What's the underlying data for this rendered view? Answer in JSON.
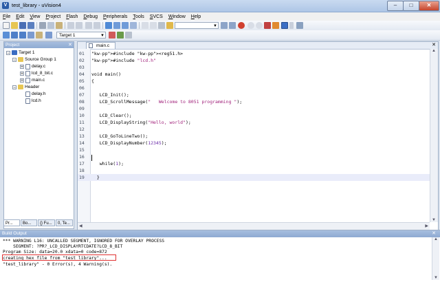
{
  "window": {
    "title": "test_library - uVision4",
    "min": "–",
    "max": "□",
    "close": "✕"
  },
  "menu": [
    "File",
    "Edit",
    "View",
    "Project",
    "Flash",
    "Debug",
    "Peripherals",
    "Tools",
    "SVCS",
    "Window",
    "Help"
  ],
  "toolbar": {
    "target_select": "Target 1"
  },
  "project": {
    "title": "Project",
    "close": "✕",
    "tree": [
      {
        "label": "Target 1",
        "level": 0,
        "kind": "target",
        "expander": "−"
      },
      {
        "label": "Source Group 1",
        "level": 1,
        "kind": "folder",
        "expander": "−"
      },
      {
        "label": "delay.c",
        "level": 2,
        "kind": "file",
        "expander": "+"
      },
      {
        "label": "lcd_8_bit.c",
        "level": 2,
        "kind": "file",
        "expander": "+"
      },
      {
        "label": "main.c",
        "level": 2,
        "kind": "file",
        "expander": "+"
      },
      {
        "label": "Header",
        "level": 1,
        "kind": "folder",
        "expander": "−"
      },
      {
        "label": "delay.h",
        "level": 2,
        "kind": "file",
        "expander": ""
      },
      {
        "label": "lcd.h",
        "level": 2,
        "kind": "file",
        "expander": ""
      }
    ],
    "tabs": [
      "Pr...",
      "Bo...",
      "{} Fu...",
      "0, Te..."
    ]
  },
  "editor": {
    "tab": "main.c",
    "close": "✕",
    "lines": [
      {
        "n": "01",
        "code": "#include <reg51.h>"
      },
      {
        "n": "02",
        "code": "#include \"lcd.h\""
      },
      {
        "n": "03",
        "code": ""
      },
      {
        "n": "04",
        "code": "void main()"
      },
      {
        "n": "05",
        "code": "{"
      },
      {
        "n": "06",
        "code": ""
      },
      {
        "n": "07",
        "code": "   LCD_Init();"
      },
      {
        "n": "08",
        "code": "   LCD_ScrollMessage(\"   Welcome to 8051 programming \");"
      },
      {
        "n": "09",
        "code": ""
      },
      {
        "n": "10",
        "code": "   LCD_Clear();"
      },
      {
        "n": "11",
        "code": "   LCD_DisplayString(\"Hello, world\");"
      },
      {
        "n": "12",
        "code": ""
      },
      {
        "n": "13",
        "code": "   LCD_GoToLineTwo();"
      },
      {
        "n": "14",
        "code": "   LCD_DisplayNumber(12345);"
      },
      {
        "n": "15",
        "code": ""
      },
      {
        "n": "16",
        "code": ""
      },
      {
        "n": "17",
        "code": "   while(1);"
      },
      {
        "n": "18",
        "code": ""
      },
      {
        "n": "19",
        "code": "  }"
      }
    ],
    "current_line": "19"
  },
  "build_output": {
    "title": "Build Output",
    "close": "✕",
    "lines": [
      "*** WARNING L16: UNCALLED SEGMENT, IGNORED FOR OVERLAY PROCESS",
      "    SEGMENT: ?PR?_LCD_DISPLAYRTCDATE?LCD_8_BIT",
      "Program Size: data=20.0 xdata=0 code=872",
      "creating hex file from \"test_library\"...",
      "\"test_library\" - 0 Error(s), 4 Warning(s)."
    ],
    "highlight_color": "#e03030"
  }
}
